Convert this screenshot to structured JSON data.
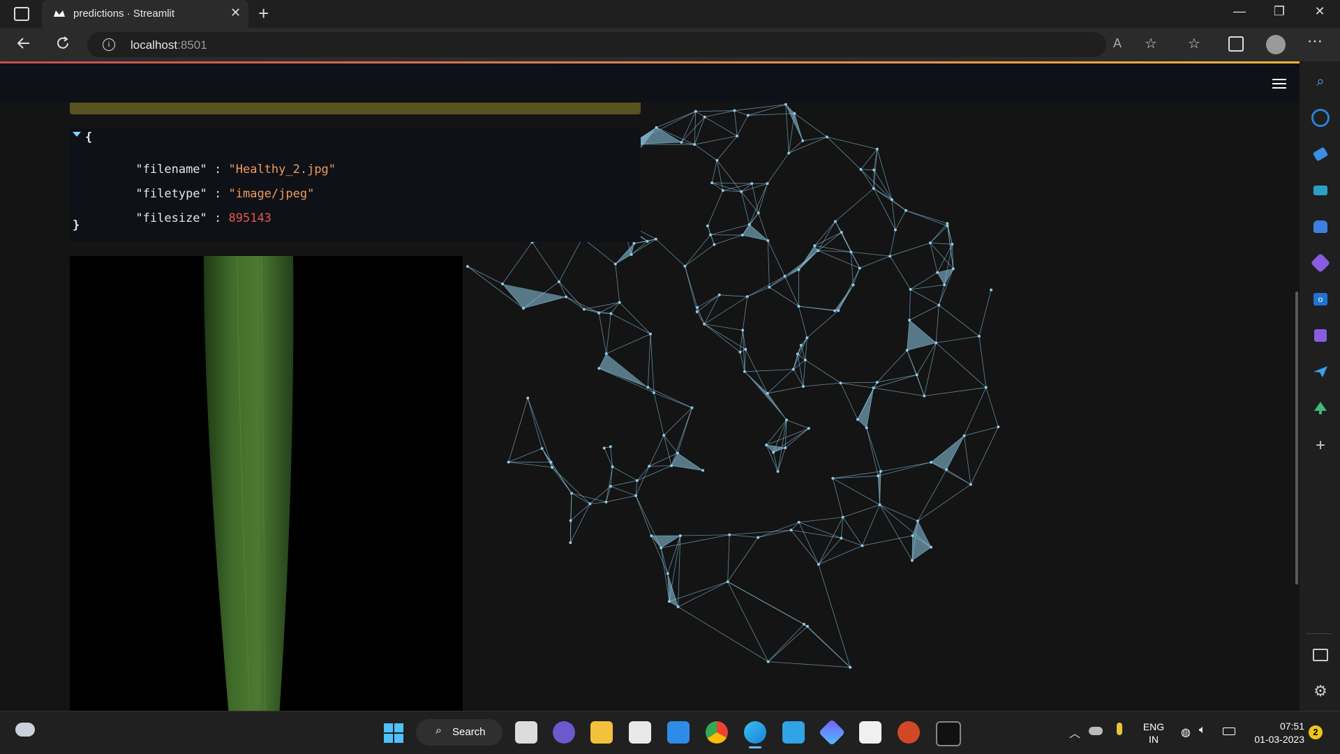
{
  "browser": {
    "tab_title": "predictions · Streamlit",
    "close_tab_glyph": "✕",
    "new_tab_glyph": "+",
    "url_host": "localhost",
    "url_port": ":8501",
    "read_aloud_label": "A",
    "window_controls": {
      "minimize": "—",
      "maximize": "❐",
      "close": "✕"
    }
  },
  "json_view": {
    "open_brace": "{",
    "close_brace": "}",
    "entries": [
      {
        "key": "\"filename\"",
        "sep": " : ",
        "value": "\"Healthy_2.jpg\"",
        "kind": "str"
      },
      {
        "key": "\"filetype\"",
        "sep": " : ",
        "value": "\"image/jpeg\"",
        "kind": "str"
      },
      {
        "key": "\"filesize\"",
        "sep": " : ",
        "value": "895143",
        "kind": "num"
      }
    ]
  },
  "taskbar": {
    "search_label": "Search",
    "lang_line1": "ENG",
    "lang_line2": "IN",
    "time": "07:51",
    "date": "01-03-2023",
    "notification_count": "2"
  },
  "colors": {
    "accent_line": "#e0834f",
    "json_string": "#f29b5d",
    "json_number": "#e5574b",
    "network": "#8ecae6"
  },
  "icons": {
    "sidebar": [
      "search-icon",
      "bing-icon",
      "shopping-icon",
      "tools-icon",
      "games-icon",
      "office-icon",
      "outlook-icon",
      "designer-icon",
      "send-icon",
      "tree-icon",
      "add-icon",
      "split-screen-icon",
      "settings-icon"
    ]
  }
}
